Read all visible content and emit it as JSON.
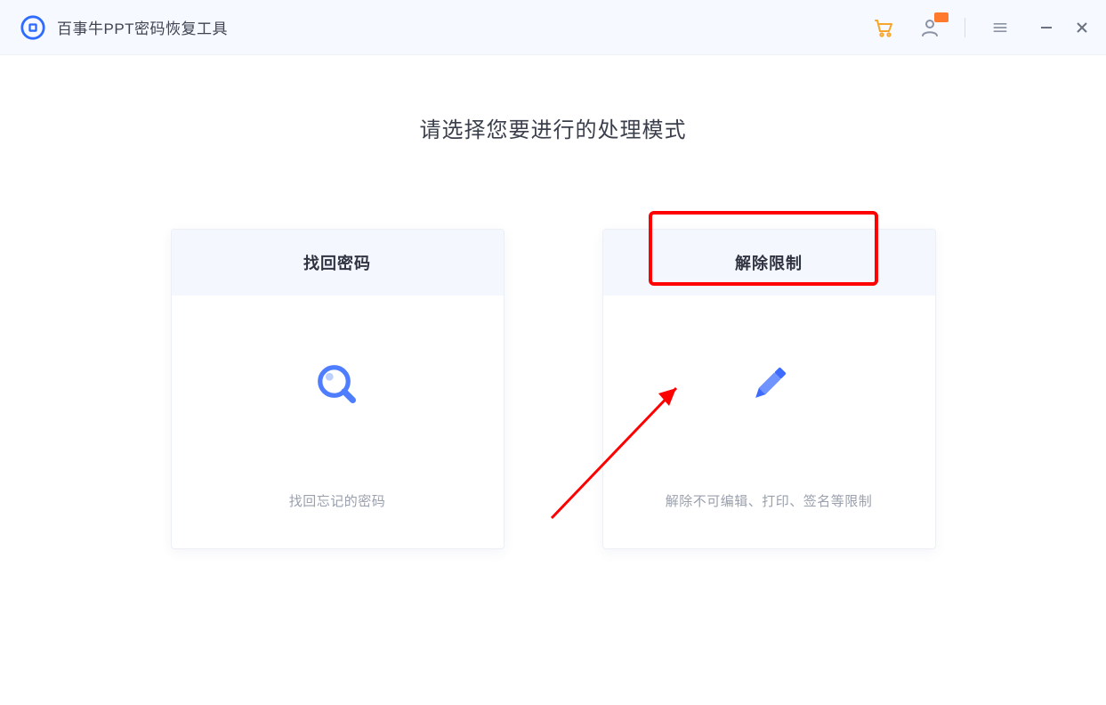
{
  "titlebar": {
    "app_title": "百事牛PPT密码恢复工具"
  },
  "main": {
    "headline": "请选择您要进行的处理模式"
  },
  "cards": {
    "recover": {
      "title": "找回密码",
      "desc": "找回忘记的密码"
    },
    "unlock": {
      "title": "解除限制",
      "desc": "解除不可编辑、打印、签名等限制"
    }
  }
}
